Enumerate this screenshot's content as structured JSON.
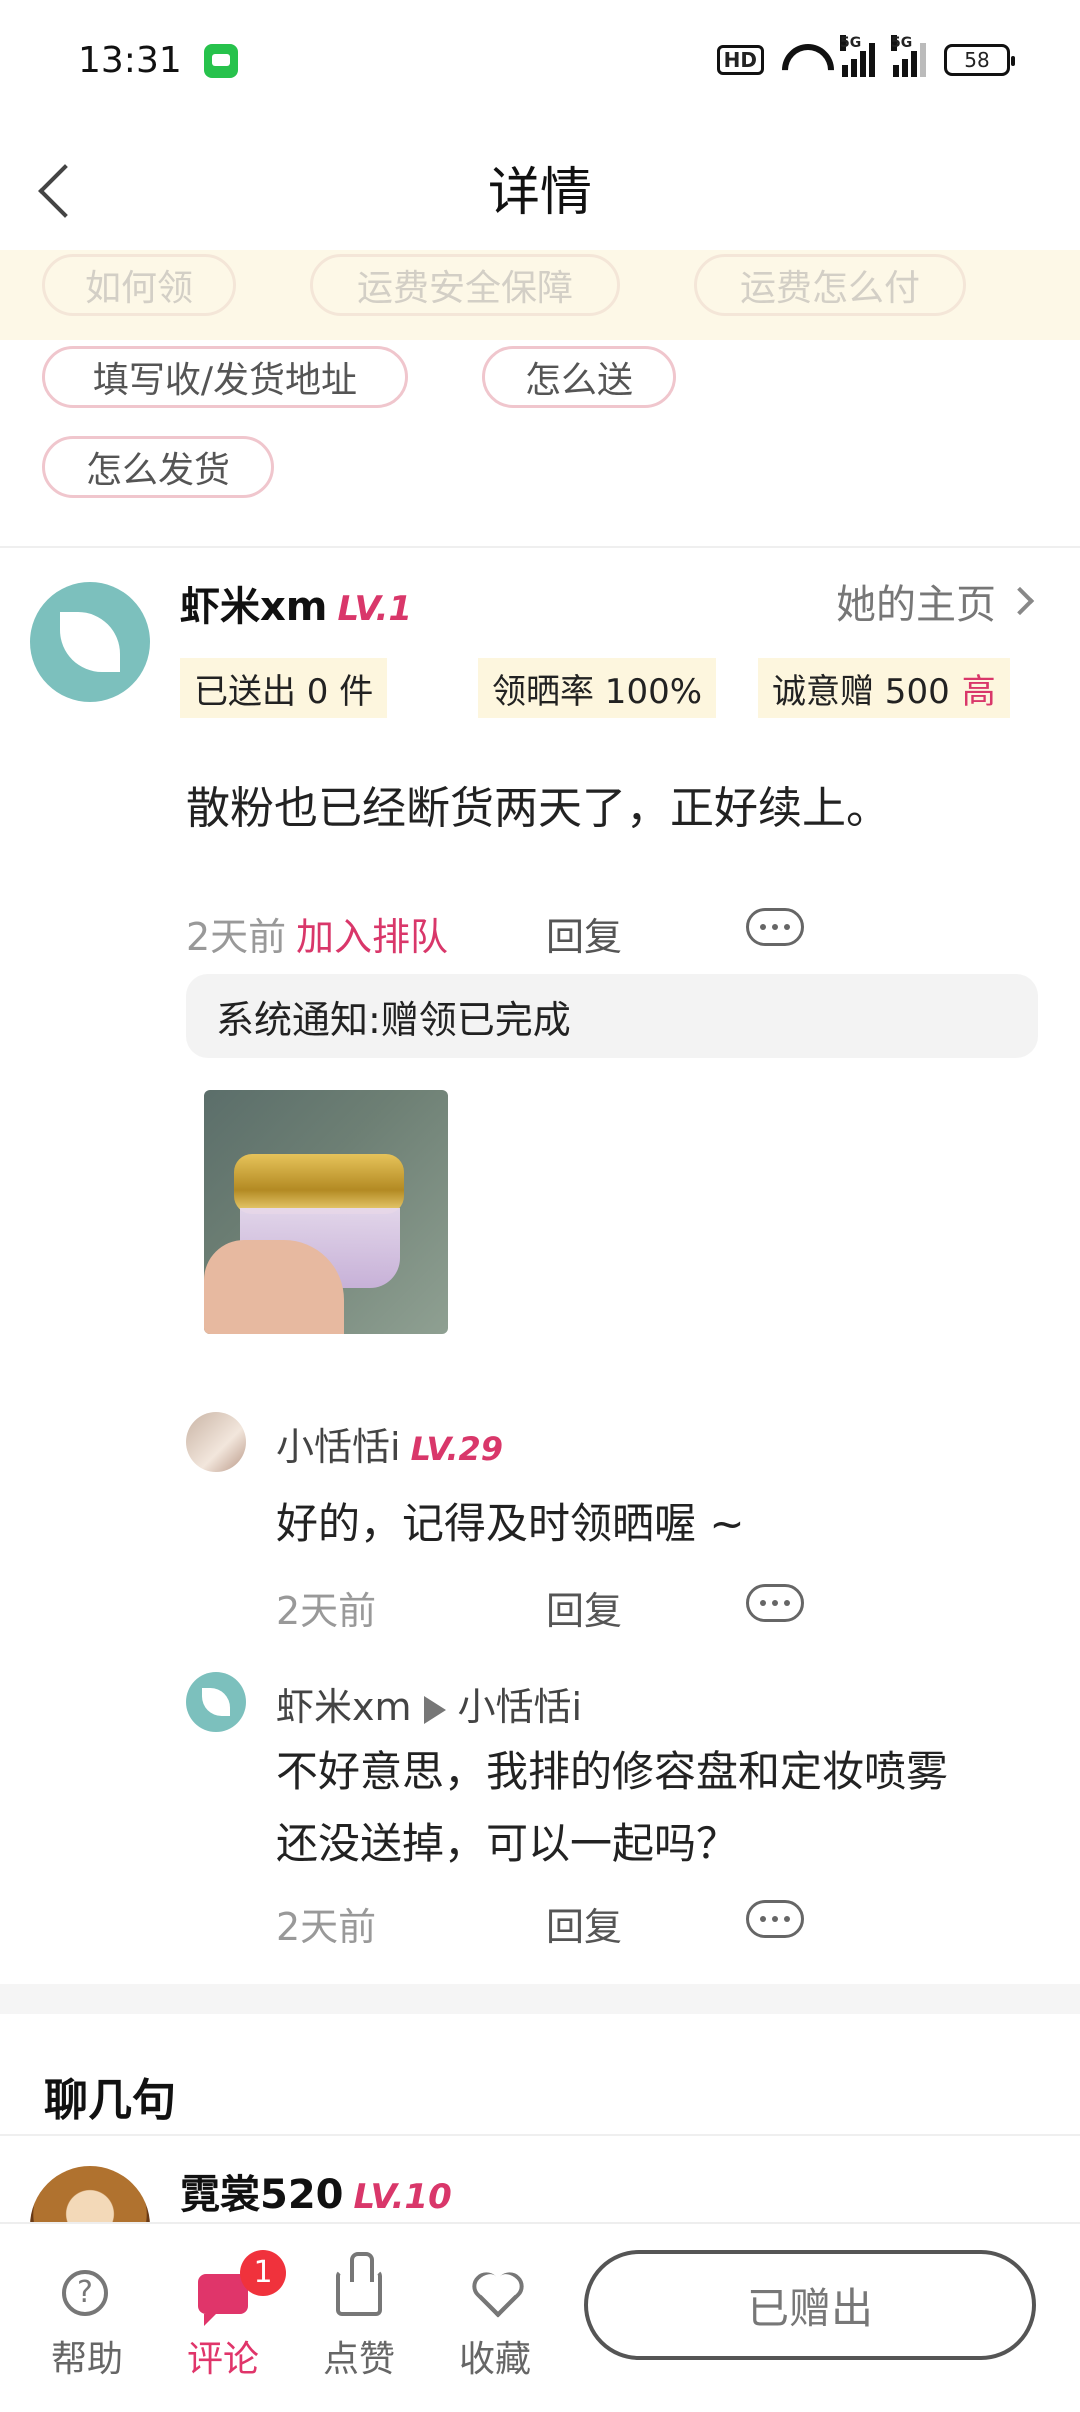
{
  "status_bar": {
    "time": "13:31",
    "hd": "HD",
    "net1": "5G",
    "net2": "5G",
    "battery": "58"
  },
  "header": {
    "title": "详情"
  },
  "tags": {
    "faded": [
      "如何领",
      "运费安全保障",
      "运费怎么付"
    ],
    "row1": [
      "填写收/发货地址",
      "怎么送"
    ],
    "row2": [
      "怎么发货"
    ]
  },
  "post": {
    "author": "虾米xm",
    "level": "LV.1",
    "homepage": "她的主页",
    "stats": {
      "sent": "已送出 0 件",
      "rate": "领晒率 100%",
      "sincerity": "诚意赠 500",
      "sincerity_tag": "高"
    },
    "content": "散粉也已经断货两天了，正好续上。",
    "time": "2天前",
    "queue_label": "加入排队",
    "reply_label": "回复",
    "system_notice": "系统通知:赠领已完成"
  },
  "comments": [
    {
      "author": "小恬恬i",
      "level": "LV.29",
      "text": "好的，记得及时领晒喔 ~",
      "time": "2天前",
      "reply_label": "回复"
    },
    {
      "author": "虾米xm",
      "reply_to": "小恬恬i",
      "text_line1": "不好意思，我排的修容盘和定妆喷雾",
      "text_line2": "还没送掉，可以一起吗？",
      "time": "2天前",
      "reply_label": "回复"
    }
  ],
  "chat_section": {
    "title": "聊几句",
    "first_user": "霓裳520",
    "first_level": "LV.10"
  },
  "bottom_bar": {
    "help": "帮助",
    "comment": "评论",
    "comment_badge": "1",
    "like": "点赞",
    "favorite": "收藏",
    "action_button": "已赠出"
  },
  "colors": {
    "accent": "#d9376a",
    "tag_band": "#fdf8e7",
    "stat_bg": "#fdf6de",
    "avatar": "#7cc0bd"
  }
}
